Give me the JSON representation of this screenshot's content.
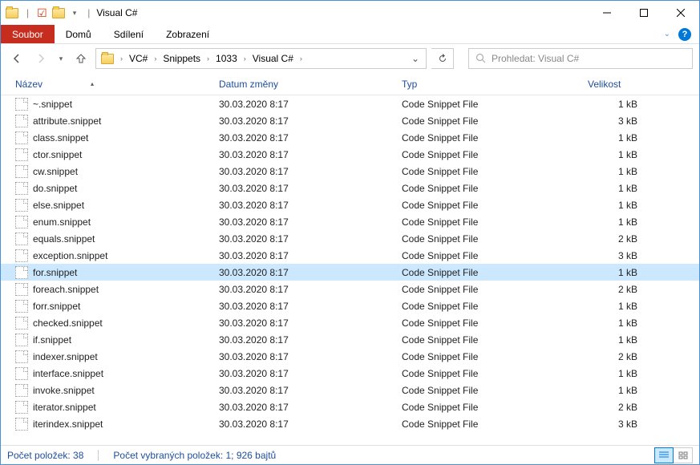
{
  "title": "Visual C#",
  "menu": {
    "file": "Soubor",
    "home": "Domů",
    "share": "Sdílení",
    "view": "Zobrazení"
  },
  "breadcrumb": [
    "VC#",
    "Snippets",
    "1033",
    "Visual C#"
  ],
  "search_placeholder": "Prohledat: Visual C#",
  "columns": {
    "name": "Název",
    "date": "Datum změny",
    "type": "Typ",
    "size": "Velikost"
  },
  "files": [
    {
      "name": "~.snippet",
      "date": "30.03.2020 8:17",
      "type": "Code Snippet File",
      "size": "1 kB",
      "selected": false
    },
    {
      "name": "attribute.snippet",
      "date": "30.03.2020 8:17",
      "type": "Code Snippet File",
      "size": "3 kB",
      "selected": false
    },
    {
      "name": "class.snippet",
      "date": "30.03.2020 8:17",
      "type": "Code Snippet File",
      "size": "1 kB",
      "selected": false
    },
    {
      "name": "ctor.snippet",
      "date": "30.03.2020 8:17",
      "type": "Code Snippet File",
      "size": "1 kB",
      "selected": false
    },
    {
      "name": "cw.snippet",
      "date": "30.03.2020 8:17",
      "type": "Code Snippet File",
      "size": "1 kB",
      "selected": false
    },
    {
      "name": "do.snippet",
      "date": "30.03.2020 8:17",
      "type": "Code Snippet File",
      "size": "1 kB",
      "selected": false
    },
    {
      "name": "else.snippet",
      "date": "30.03.2020 8:17",
      "type": "Code Snippet File",
      "size": "1 kB",
      "selected": false
    },
    {
      "name": "enum.snippet",
      "date": "30.03.2020 8:17",
      "type": "Code Snippet File",
      "size": "1 kB",
      "selected": false
    },
    {
      "name": "equals.snippet",
      "date": "30.03.2020 8:17",
      "type": "Code Snippet File",
      "size": "2 kB",
      "selected": false
    },
    {
      "name": "exception.snippet",
      "date": "30.03.2020 8:17",
      "type": "Code Snippet File",
      "size": "3 kB",
      "selected": false
    },
    {
      "name": "for.snippet",
      "date": "30.03.2020 8:17",
      "type": "Code Snippet File",
      "size": "1 kB",
      "selected": true
    },
    {
      "name": "foreach.snippet",
      "date": "30.03.2020 8:17",
      "type": "Code Snippet File",
      "size": "2 kB",
      "selected": false
    },
    {
      "name": "forr.snippet",
      "date": "30.03.2020 8:17",
      "type": "Code Snippet File",
      "size": "1 kB",
      "selected": false
    },
    {
      "name": "checked.snippet",
      "date": "30.03.2020 8:17",
      "type": "Code Snippet File",
      "size": "1 kB",
      "selected": false
    },
    {
      "name": "if.snippet",
      "date": "30.03.2020 8:17",
      "type": "Code Snippet File",
      "size": "1 kB",
      "selected": false
    },
    {
      "name": "indexer.snippet",
      "date": "30.03.2020 8:17",
      "type": "Code Snippet File",
      "size": "2 kB",
      "selected": false
    },
    {
      "name": "interface.snippet",
      "date": "30.03.2020 8:17",
      "type": "Code Snippet File",
      "size": "1 kB",
      "selected": false
    },
    {
      "name": "invoke.snippet",
      "date": "30.03.2020 8:17",
      "type": "Code Snippet File",
      "size": "1 kB",
      "selected": false
    },
    {
      "name": "iterator.snippet",
      "date": "30.03.2020 8:17",
      "type": "Code Snippet File",
      "size": "2 kB",
      "selected": false
    },
    {
      "name": "iterindex.snippet",
      "date": "30.03.2020 8:17",
      "type": "Code Snippet File",
      "size": "3 kB",
      "selected": false
    }
  ],
  "status": {
    "count": "Počet položek: 38",
    "selected": "Počet vybraných položek: 1; 926 bajtů"
  }
}
